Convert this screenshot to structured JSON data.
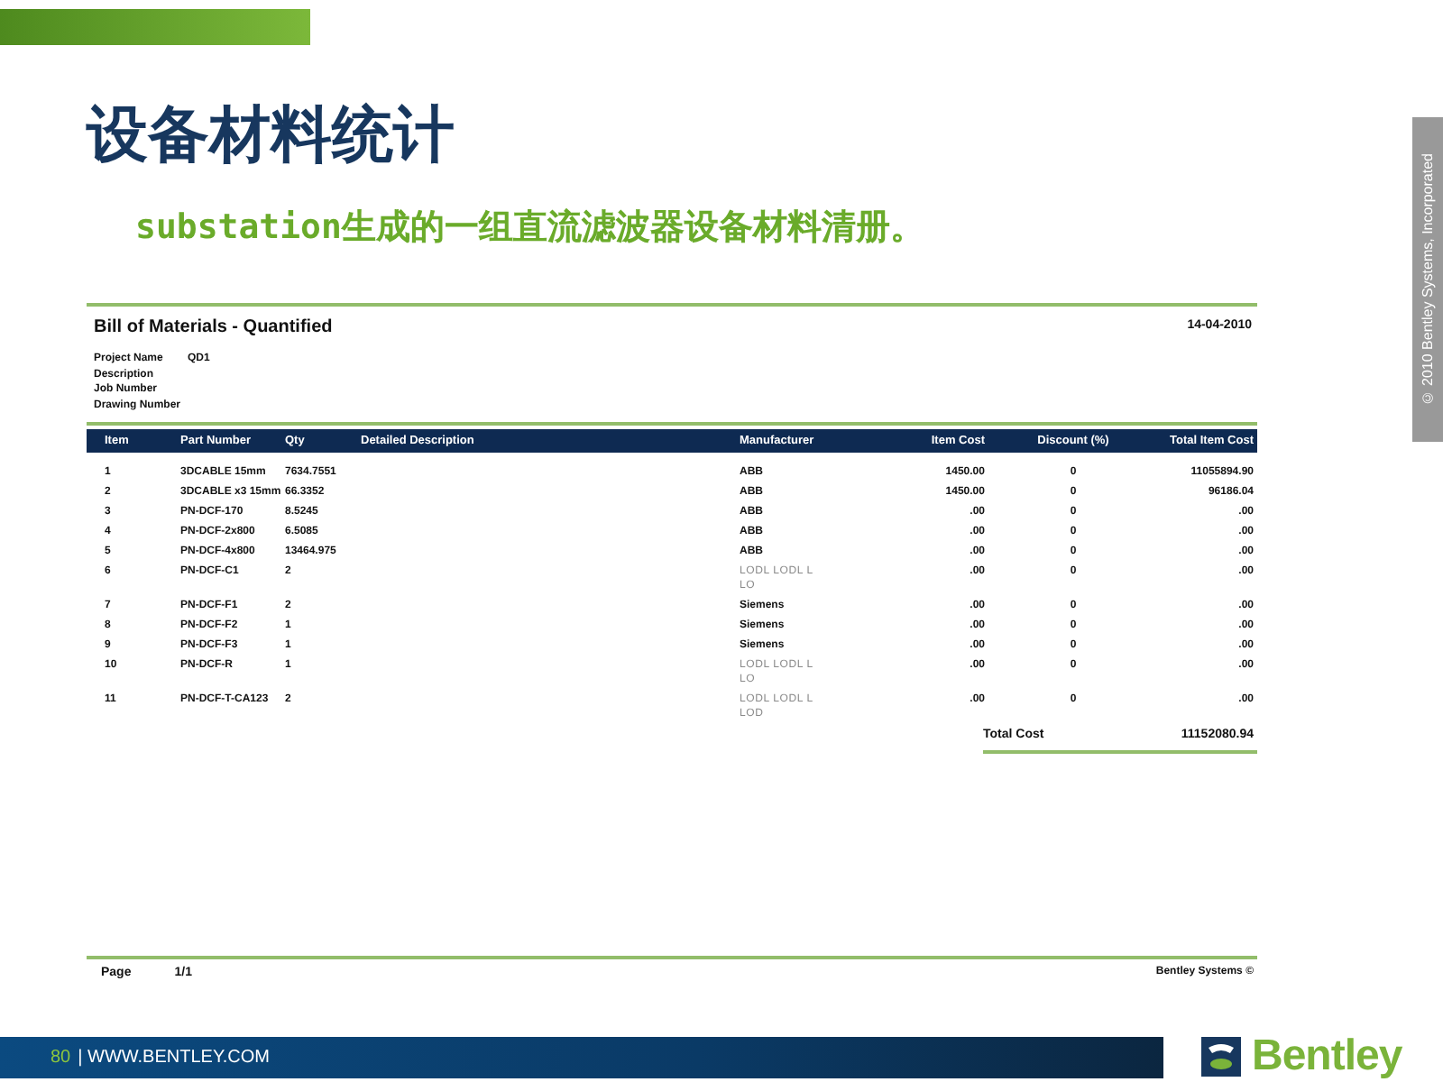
{
  "slide": {
    "title": "设备材料统计",
    "subtitle": "substation生成的一组直流滤波器设备材料清册。",
    "side_note": "© 2010 Bentley Systems, Incorporated"
  },
  "report": {
    "title": "Bill of Materials - Quantified",
    "date": "14-04-2010",
    "meta": [
      {
        "label": "Project Name",
        "value": "QD1"
      },
      {
        "label": "Description"
      },
      {
        "label": "Job Number"
      },
      {
        "label": "Drawing Number"
      }
    ],
    "columns": [
      "Item",
      "Part Number",
      "Qty",
      "Detailed Description",
      "Manufacturer",
      "Item Cost",
      "Discount (%)",
      "Total Item Cost"
    ],
    "rows": [
      {
        "item": "1",
        "part": "3DCABLE 15mm",
        "qty": "7634.7551",
        "manufacturer": "ABB",
        "dim": false,
        "item_cost": "1450.00",
        "discount": "0",
        "total": "11055894.90"
      },
      {
        "item": "2",
        "part": "3DCABLE x3 15mm",
        "qty": "66.3352",
        "manufacturer": "ABB",
        "dim": false,
        "item_cost": "1450.00",
        "discount": "0",
        "total": "96186.04"
      },
      {
        "item": "3",
        "part": "PN-DCF-170",
        "qty": "8.5245",
        "manufacturer": "ABB",
        "dim": false,
        "item_cost": ".00",
        "discount": "0",
        "total": ".00"
      },
      {
        "item": "4",
        "part": "PN-DCF-2x800",
        "qty": "6.5085",
        "manufacturer": "ABB",
        "dim": false,
        "item_cost": ".00",
        "discount": "0",
        "total": ".00"
      },
      {
        "item": "5",
        "part": "PN-DCF-4x800",
        "qty": "13464.975",
        "manufacturer": "ABB",
        "dim": false,
        "item_cost": ".00",
        "discount": "0",
        "total": ".00"
      },
      {
        "item": "6",
        "part": "PN-DCF-C1",
        "qty": "2",
        "manufacturer": "LODL LODL L\nLO",
        "dim": true,
        "item_cost": ".00",
        "discount": "0",
        "total": ".00"
      },
      {
        "item": "7",
        "part": "PN-DCF-F1",
        "qty": "2",
        "manufacturer": "Siemens",
        "dim": false,
        "item_cost": ".00",
        "discount": "0",
        "total": ".00"
      },
      {
        "item": "8",
        "part": "PN-DCF-F2",
        "qty": "1",
        "manufacturer": "Siemens",
        "dim": false,
        "item_cost": ".00",
        "discount": "0",
        "total": ".00"
      },
      {
        "item": "9",
        "part": "PN-DCF-F3",
        "qty": "1",
        "manufacturer": "Siemens",
        "dim": false,
        "item_cost": ".00",
        "discount": "0",
        "total": ".00"
      },
      {
        "item": "10",
        "part": "PN-DCF-R",
        "qty": "1",
        "manufacturer": "LODL LODL L\nLO",
        "dim": true,
        "item_cost": ".00",
        "discount": "0",
        "total": ".00"
      },
      {
        "item": "11",
        "part": "PN-DCF-T-CA123",
        "qty": "2",
        "manufacturer": "LODL LODL L\nLOD",
        "dim": true,
        "item_cost": ".00",
        "discount": "0",
        "total": ".00"
      }
    ],
    "total_label": "Total Cost",
    "total_value": "11152080.94",
    "footer": {
      "page_label": "Page",
      "page_value": "1/1",
      "company": "Bentley Systems ©"
    }
  },
  "bottom_bar": {
    "page_number": "80",
    "url": "| WWW.BENTLEY.COM"
  },
  "logo": {
    "text": "Bentley"
  }
}
